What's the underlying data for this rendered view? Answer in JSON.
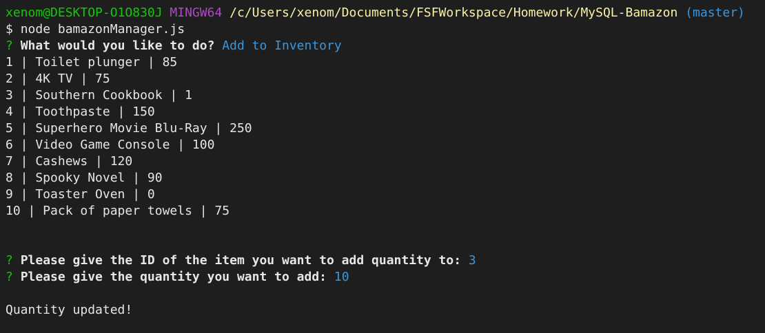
{
  "terminal": {
    "prompt": {
      "user_host": "xenom@DESKTOP-O1O830J",
      "env": "MINGW64",
      "path": "/c/Users/xenom/Documents/FSFWorkspace/Homework/MySQL-Bamazon",
      "branch": "(master)"
    },
    "command": {
      "symbol": "$",
      "text": "node bamazonManager.js"
    },
    "question_mark": "?",
    "q1": {
      "text": "What would you like to do?",
      "answer": "Add to Inventory"
    },
    "inventory": [
      "1 | Toilet plunger | 85",
      "2 | 4K TV | 75",
      "3 | Southern Cookbook | 1",
      "4 | Toothpaste | 150",
      "5 | Superhero Movie Blu-Ray | 250",
      "6 | Video Game Console | 100",
      "7 | Cashews | 120",
      "8 | Spooky Novel | 90",
      "9 | Toaster Oven | 0",
      "10 | Pack of paper towels | 75"
    ],
    "q2": {
      "text": "Please give the ID of the item you want to add quantity to:",
      "answer": "3"
    },
    "q3": {
      "text": "Please give the quantity you want to add:",
      "answer": "10"
    },
    "result": "Quantity updated!"
  },
  "colors": {
    "background": "#1e1e1e",
    "text": "#e6e6e6",
    "green": "#16c60c",
    "magenta": "#b148c6",
    "yellow": "#f9f1a5",
    "cyan": "#3a96dd"
  }
}
